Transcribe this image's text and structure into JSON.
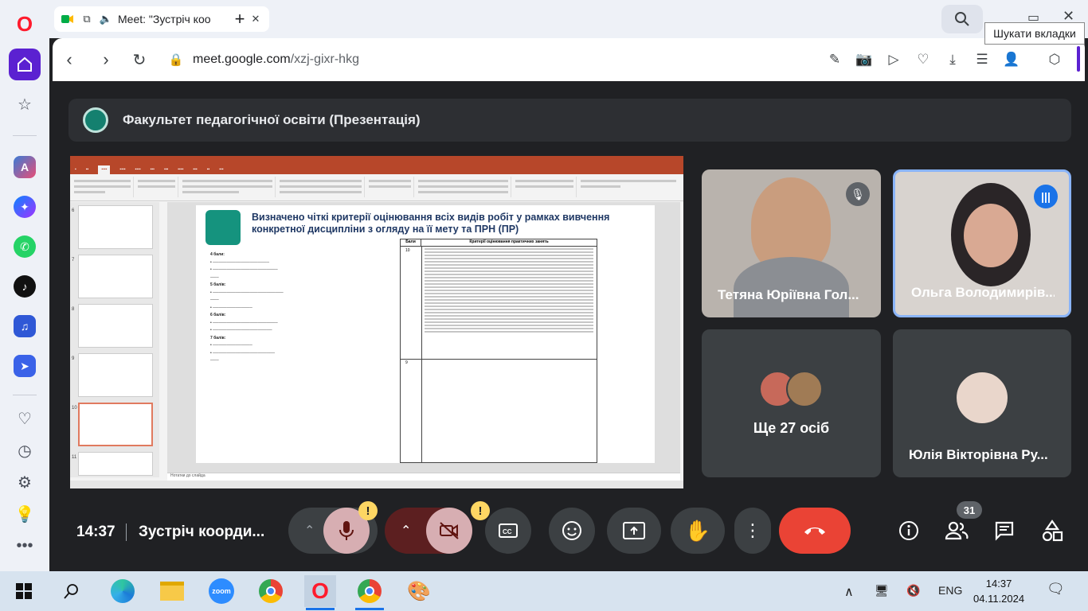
{
  "browser": {
    "tab_title": "Meet: \"Зустріч коо",
    "url_host": "meet.google.com",
    "url_path": "/xzj-gixr-hkg",
    "search_tabs_tooltip": "Шукати вкладки"
  },
  "meet": {
    "presenter_title": "Факультет педагогічної освіти (Презентація)",
    "slide": {
      "title": "Визначено чіткі критерії оцінювання всіх видів робіт у рамках вивчення конкретної дисципліни з огляду на її мету та ПРН (ПР)",
      "col_score": "Бали",
      "col_criteria": "Критерії оцінювання практичних занять",
      "row1_score": "10",
      "row2_score": "9",
      "left_heading_4": "4 бали:",
      "left_heading_5": "5 балів:",
      "left_heading_6": "6 балів:",
      "left_heading_7": "7 балів:",
      "notes": "Нотатки до слайда"
    },
    "participants": [
      {
        "name": "Тетяна Юріївна Гол...",
        "state": "muted"
      },
      {
        "name": "Ольга Володимирів...",
        "state": "speaking"
      },
      {
        "name": "Ще 27 осіб"
      },
      {
        "name": "Юлія Вікторівна Ру..."
      }
    ],
    "time": "14:37",
    "meeting_name": "Зустріч коорди...",
    "participant_count": "31",
    "alert_mark": "!"
  },
  "taskbar": {
    "lang": "ENG",
    "time": "14:37",
    "date": "04.11.2024"
  },
  "colors": {
    "opera_red": "#ff1b2d",
    "home": "#5b21d1",
    "end_call": "#ea4335",
    "speaking": "#8ab4f8",
    "alert": "#fdd663"
  }
}
